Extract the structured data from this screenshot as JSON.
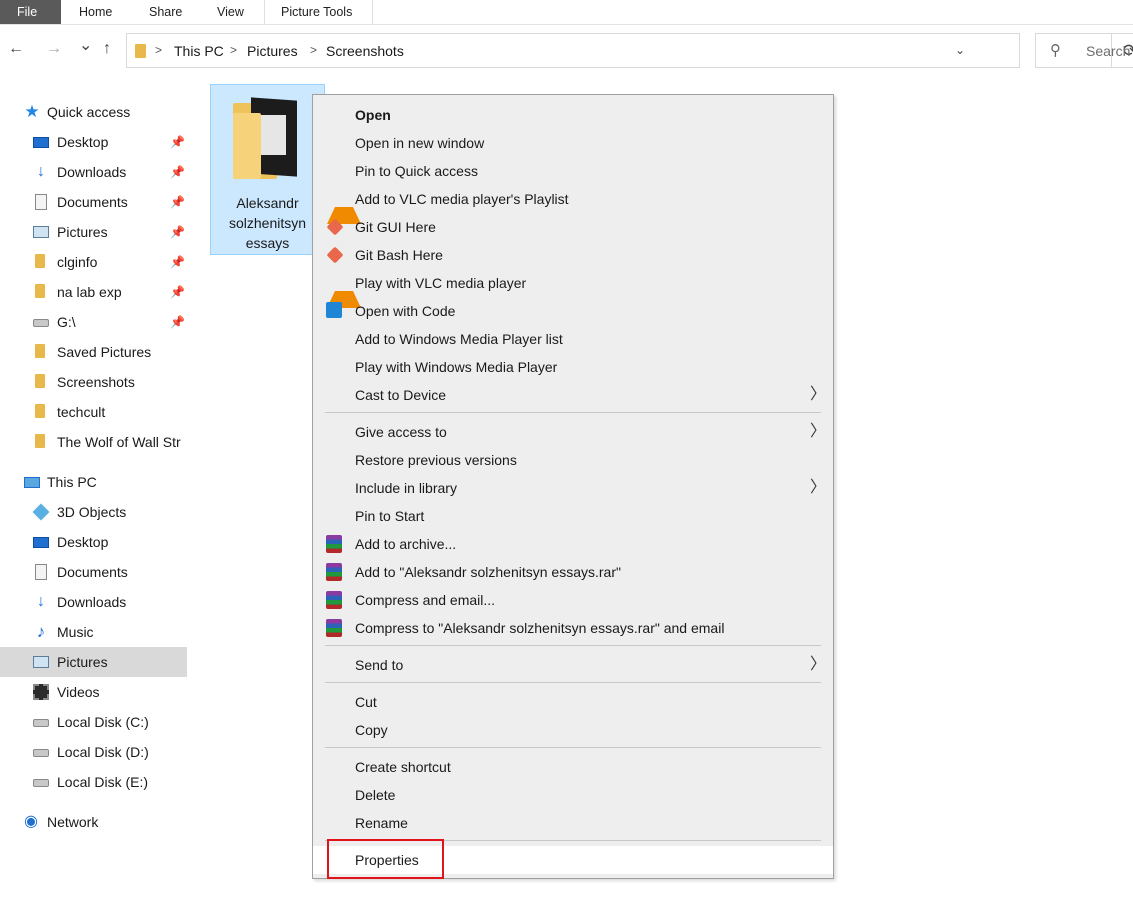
{
  "ribbon": {
    "tabs": [
      "File",
      "Home",
      "Share",
      "View",
      "Picture Tools"
    ]
  },
  "nav": {
    "back_icon": "←",
    "forward_icon": "→",
    "recent_icon": "⌄",
    "up_icon": "↑",
    "breadcrumb": [
      "This PC",
      "Pictures",
      "Screenshots"
    ],
    "refresh_icon": "⟳",
    "search_placeholder": "Search"
  },
  "sidebar": {
    "quick_access": "Quick access",
    "quick_items": [
      {
        "label": "Desktop",
        "icon": "desktop-icon"
      },
      {
        "label": "Downloads",
        "icon": "downloads-icon"
      },
      {
        "label": "Documents",
        "icon": "documents-icon"
      },
      {
        "label": "Pictures",
        "icon": "pictures-icon"
      },
      {
        "label": "clginfo",
        "icon": "folder-icon"
      },
      {
        "label": "na lab exp",
        "icon": "folder-icon"
      },
      {
        "label": "G:\\",
        "icon": "drive-icon"
      },
      {
        "label": "Saved Pictures",
        "icon": "folder-icon"
      },
      {
        "label": "Screenshots",
        "icon": "folder-icon"
      },
      {
        "label": "techcult",
        "icon": "folder-icon"
      },
      {
        "label": "The Wolf of Wall Str",
        "icon": "folder-icon"
      }
    ],
    "this_pc": "This PC",
    "pc_items": [
      {
        "label": "3D Objects",
        "icon": "3d-objects-icon"
      },
      {
        "label": "Desktop",
        "icon": "desktop-icon"
      },
      {
        "label": "Documents",
        "icon": "documents-icon"
      },
      {
        "label": "Downloads",
        "icon": "downloads-icon"
      },
      {
        "label": "Music",
        "icon": "music-icon"
      },
      {
        "label": "Pictures",
        "icon": "pictures-icon"
      },
      {
        "label": "Videos",
        "icon": "videos-icon"
      },
      {
        "label": "Local Disk (C:)",
        "icon": "drive-icon"
      },
      {
        "label": "Local Disk (D:)",
        "icon": "drive-icon"
      },
      {
        "label": "Local Disk (E:)",
        "icon": "drive-icon"
      }
    ],
    "network": "Network",
    "selected": "Pictures"
  },
  "folder": {
    "name_lines": [
      "Aleksandr",
      "solzhenitsyn",
      "essays"
    ]
  },
  "context_menu": {
    "items": [
      {
        "label": "Open",
        "bold": true
      },
      {
        "label": "Open in new window"
      },
      {
        "label": "Pin to Quick access"
      },
      {
        "label": "Add to VLC media player's Playlist",
        "icon": "vlc-icon"
      },
      {
        "label": "Git GUI Here",
        "icon": "git-icon"
      },
      {
        "label": "Git Bash Here",
        "icon": "git-icon"
      },
      {
        "label": "Play with VLC media player",
        "icon": "vlc-icon"
      },
      {
        "label": "Open with Code",
        "icon": "vscode-icon"
      },
      {
        "label": "Add to Windows Media Player list"
      },
      {
        "label": "Play with Windows Media Player"
      },
      {
        "label": "Cast to Device",
        "submenu": true
      },
      {
        "label": "Give access to",
        "submenu": true
      },
      {
        "label": "Restore previous versions"
      },
      {
        "label": "Include in library",
        "submenu": true
      },
      {
        "label": "Pin to Start"
      },
      {
        "label": "Add to archive...",
        "icon": "winrar-icon"
      },
      {
        "label": "Add to \"Aleksandr solzhenitsyn essays.rar\"",
        "icon": "winrar-icon"
      },
      {
        "label": "Compress and email...",
        "icon": "winrar-icon"
      },
      {
        "label": "Compress to \"Aleksandr solzhenitsyn essays.rar\" and email",
        "icon": "winrar-icon"
      },
      {
        "label": "Send to",
        "submenu": true
      },
      {
        "label": "Cut"
      },
      {
        "label": "Copy"
      },
      {
        "label": "Create shortcut"
      },
      {
        "label": "Delete"
      },
      {
        "label": "Rename"
      },
      {
        "label": "Properties",
        "hovered": true
      }
    ],
    "highlight_color": "#e1141c"
  }
}
